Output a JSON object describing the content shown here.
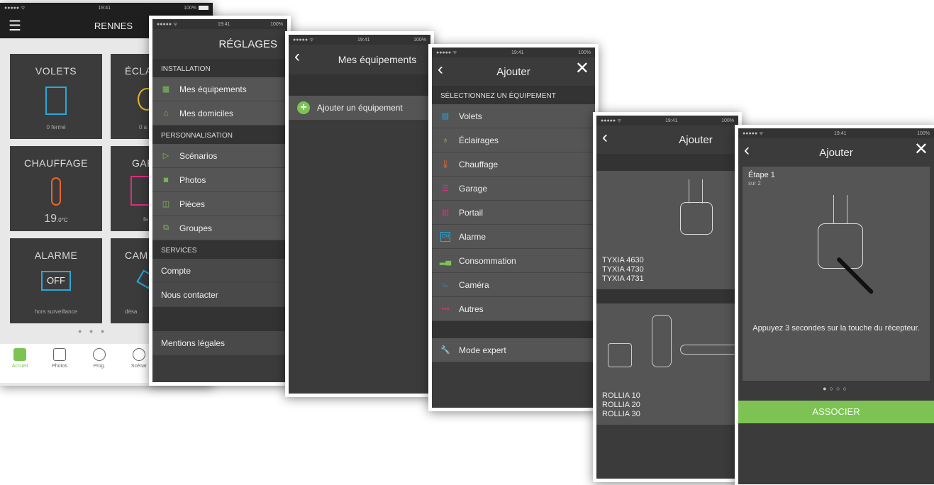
{
  "status": {
    "time": "19:41",
    "battery": "100%",
    "signal": "●●●●● ᯤ"
  },
  "screen1": {
    "title": "RENNES",
    "menu_icon": "menu-icon",
    "tiles": [
      {
        "title": "VOLETS",
        "sub": "0 fermé"
      },
      {
        "title": "ÉCLA",
        "sub": "0 a"
      },
      {
        "title": "CHAUFFAGE",
        "value": "19",
        "unit": ".0°C"
      },
      {
        "title": "GAR",
        "sub": "fe"
      },
      {
        "title": "ALARME",
        "badge": "OFF",
        "sub": "hors surveillance"
      },
      {
        "title": "CAM",
        "sub": "désa"
      }
    ],
    "tabs": [
      "Accueil",
      "Photos",
      "Prog.",
      "Scénar"
    ]
  },
  "screen2": {
    "title": "RÉGLAGES",
    "sections": [
      {
        "label": "INSTALLATION",
        "items": [
          "Mes équipements",
          "Mes domiciles"
        ]
      },
      {
        "label": "PERSONNALISATION",
        "items": [
          "Scénarios",
          "Photos",
          "Pièces",
          "Groupes"
        ]
      },
      {
        "label": "SERVICES",
        "items": [
          "Compte",
          "Nous contacter"
        ]
      }
    ],
    "legal": "Mentions légales"
  },
  "screen3": {
    "title": "Mes équipements",
    "add": "Ajouter un équipement"
  },
  "screen4": {
    "title": "Ajouter",
    "section": "SÉLECTIONNEZ UN ÉQUIPEMENT",
    "items": [
      "Volets",
      "Éclairages",
      "Chauffage",
      "Garage",
      "Portail",
      "Alarme",
      "Consommation",
      "Caméra",
      "Autres"
    ],
    "expert": "Mode expert",
    "colors": {
      "volets": "#2aa8d8",
      "eclairages": "#e8b92a",
      "chauffage": "#e8662a",
      "garage": "#d8307e",
      "portail": "#d8307e",
      "alarme": "#2aa8d8",
      "conso": "#7cc354",
      "camera": "#2aa8d8",
      "autres": "#d8307e",
      "expert": "#7cc354"
    }
  },
  "screen5": {
    "title": "Ajouter",
    "group1": [
      "TYXIA 4630",
      "TYXIA 4730",
      "TYXIA 4731"
    ],
    "group2": [
      "ROLLIA 10",
      "ROLLIA 20",
      "ROLLIA 30"
    ]
  },
  "screen6": {
    "title": "Ajouter",
    "step": "Étape 1",
    "step_sub": "sur 2",
    "instruction": "Appuyez 3 secondes sur la touche du récepteur.",
    "button": "ASSOCIER",
    "accent": "#7cc354"
  }
}
